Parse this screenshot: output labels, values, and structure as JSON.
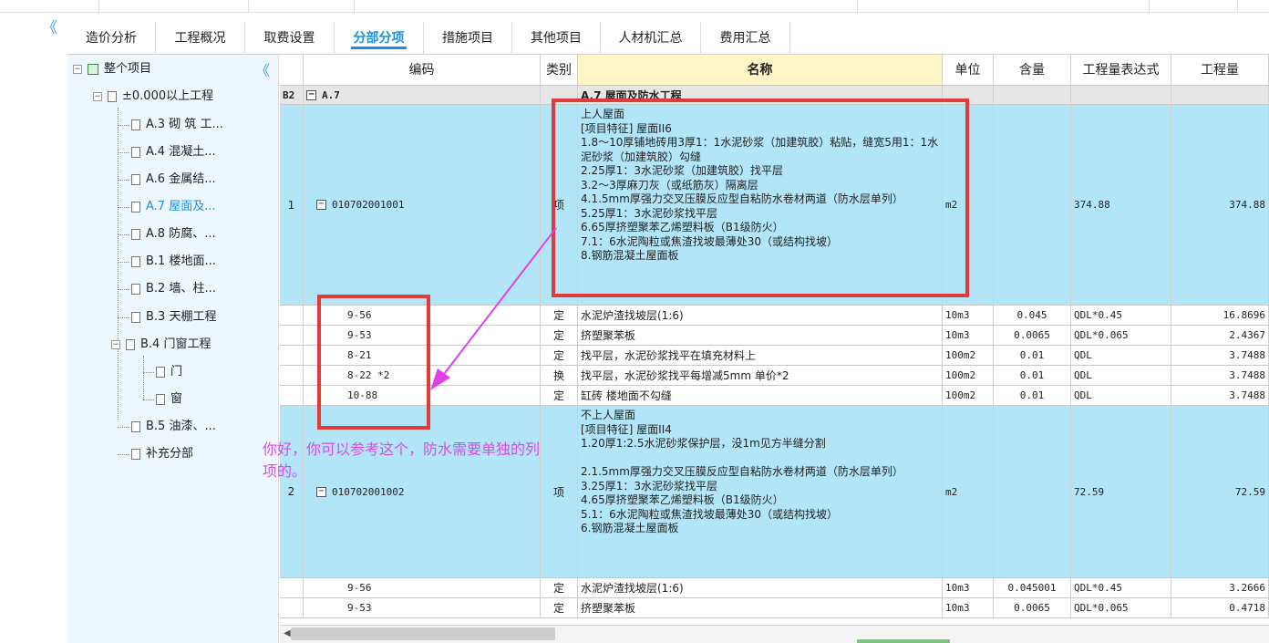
{
  "collapse_glyph": "《",
  "tabs": [
    {
      "label": "造价分析"
    },
    {
      "label": "工程概况"
    },
    {
      "label": "取费设置"
    },
    {
      "label": "分部分项",
      "active": true
    },
    {
      "label": "措施项目"
    },
    {
      "label": "其他项目"
    },
    {
      "label": "人材机汇总"
    },
    {
      "label": "费用汇总"
    }
  ],
  "tree": {
    "root": "整个项目",
    "level1": "±0.000以上工程",
    "items": [
      "A.3 砌 筑 工...",
      "A.4 混凝土...",
      "A.6 金属结...",
      "A.7 屋面及...",
      "A.8 防腐、...",
      "B.1 楼地面...",
      "B.2 墙、柱...",
      "B.3 天棚工程",
      "B.4 门窗工程",
      "门",
      "窗",
      "B.5 油漆、...",
      "补充分部"
    ],
    "selected": "A.7 屋面及..."
  },
  "grid": {
    "headers": {
      "seq": "",
      "code": "编码",
      "type": "类别",
      "name": "名称",
      "unit": "单位",
      "qty_ratio": "含量",
      "expr": "工程量表达式",
      "qty": "工程量"
    },
    "group": {
      "level": "B2",
      "code": "A.7",
      "name": "A.7 屋面及防水工程"
    },
    "rows": [
      {
        "seq": "1",
        "code": "010702001001",
        "type": "项",
        "name": "上人屋面\n[项目特征] 屋面II6\n1.8～10厚铺地砖用3厚1：1水泥砂浆（加建筑胶）粘贴，缝宽5用1：1水泥砂浆（加建筑胶）勾缝\n2.25厚1：3水泥砂浆（加建筑胶）找平层\n3.2～3厚麻刀灰（或纸筋灰）隔离层\n4.1.5mm厚强力交叉压膜反应型自粘防水卷材两道（防水层单列）\n5.25厚1：3水泥砂浆找平层\n6.65厚挤塑聚苯乙烯塑料板（B1级防火）\n7.1：6水泥陶粒或焦渣找坡最薄处30（或结构找坡）\n8.钢筋混凝土屋面板",
        "unit": "m2",
        "ratio": "",
        "expr": "374.88",
        "qty": "374.88"
      },
      {
        "code": "9-56",
        "type": "定",
        "name": "水泥炉渣找坡层(1:6)",
        "unit": "10m3",
        "ratio": "0.045",
        "expr": "QDL*0.45",
        "qty": "16.8696"
      },
      {
        "code": "9-53",
        "type": "定",
        "name": "挤塑聚苯板",
        "unit": "10m3",
        "ratio": "0.0065",
        "expr": "QDL*0.065",
        "qty": "2.4367"
      },
      {
        "code": "8-21",
        "type": "定",
        "name": "找平层，水泥砂浆找平在填充材料上",
        "unit": "100m2",
        "ratio": "0.01",
        "expr": "QDL",
        "qty": "3.7488"
      },
      {
        "code": "8-22 *2",
        "type": "换",
        "name": "找平层，水泥砂浆找平每增减5mm 单价*2",
        "unit": "100m2",
        "ratio": "0.01",
        "expr": "QDL",
        "qty": "3.7488"
      },
      {
        "code": "10-88",
        "type": "定",
        "name": "缸砖 楼地面不勾缝",
        "unit": "100m2",
        "ratio": "0.01",
        "expr": "QDL",
        "qty": "3.7488"
      },
      {
        "seq": "2",
        "code": "010702001002",
        "type": "项",
        "name": "不上人屋面\n[项目特征] 屋面II4\n1.20厚1:2.5水泥砂浆保护层，没1m见方半缝分割\n\n2.1.5mm厚强力交叉压膜反应型自粘防水卷材两道（防水层单列）\n3.25厚1：3水泥砂浆找平层\n4.65厚挤塑聚苯乙烯塑料板（B1级防火）\n5.1：6水泥陶粒或焦渣找坡最薄处30（或结构找坡）\n6.钢筋混凝土屋面板",
        "unit": "m2",
        "ratio": "",
        "expr": "72.59",
        "qty": "72.59"
      },
      {
        "code": "9-56",
        "type": "定",
        "name": "水泥炉渣找坡层(1:6)",
        "unit": "10m3",
        "ratio": "0.045001",
        "expr": "QDL*0.45",
        "qty": "3.2666"
      },
      {
        "code": "9-53",
        "type": "定",
        "name": "挤塑聚苯板",
        "unit": "10m3",
        "ratio": "0.0065",
        "expr": "QDL*0.065",
        "qty": "0.4718"
      }
    ]
  },
  "annotation": "你好，你可以参考这个，防水需要单独的列项的。",
  "colors": {
    "accent": "#1a8fe3",
    "highlight_row": "#b3e5f8",
    "name_header": "#fff5c6",
    "annotation": "#d84ae4",
    "red_box": "#e03a3a"
  }
}
